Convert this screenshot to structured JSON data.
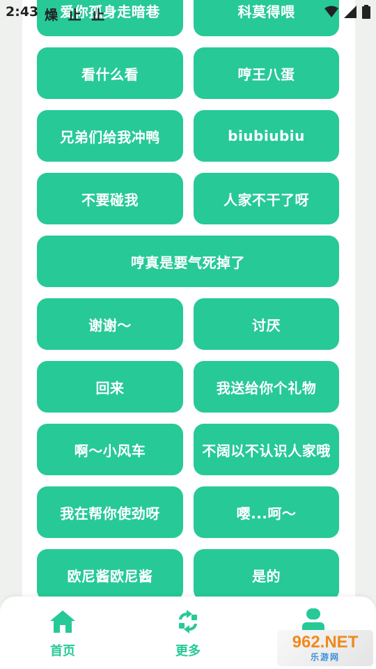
{
  "status_bar": {
    "time": "2:43",
    "notification_glyphs": "燥 止 止"
  },
  "buttons": [
    "爱你孤身走暗巷",
    "科莫得喂",
    "看什么看",
    "哼王八蛋",
    "兄弟们给我冲鸭",
    "biubiubiu",
    "不要碰我",
    "人家不干了呀",
    "哼真是要气死掉了",
    "谢谢～",
    "讨厌",
    "回来",
    "我送给你个礼物",
    "啊～小风车",
    "不阔以不认识人家哦",
    "我在帮你使劲呀",
    "嘤...呵～",
    "欧尼酱欧尼酱",
    "是的"
  ],
  "nav": {
    "home_label": "首页",
    "more_label": "更多",
    "profile_icon": "person-icon"
  },
  "watermark": {
    "brand": "962.NET",
    "sub": "乐游网"
  },
  "colors": {
    "accent": "#27c997",
    "background": "#eef1ee",
    "panel": "#ffffff"
  }
}
